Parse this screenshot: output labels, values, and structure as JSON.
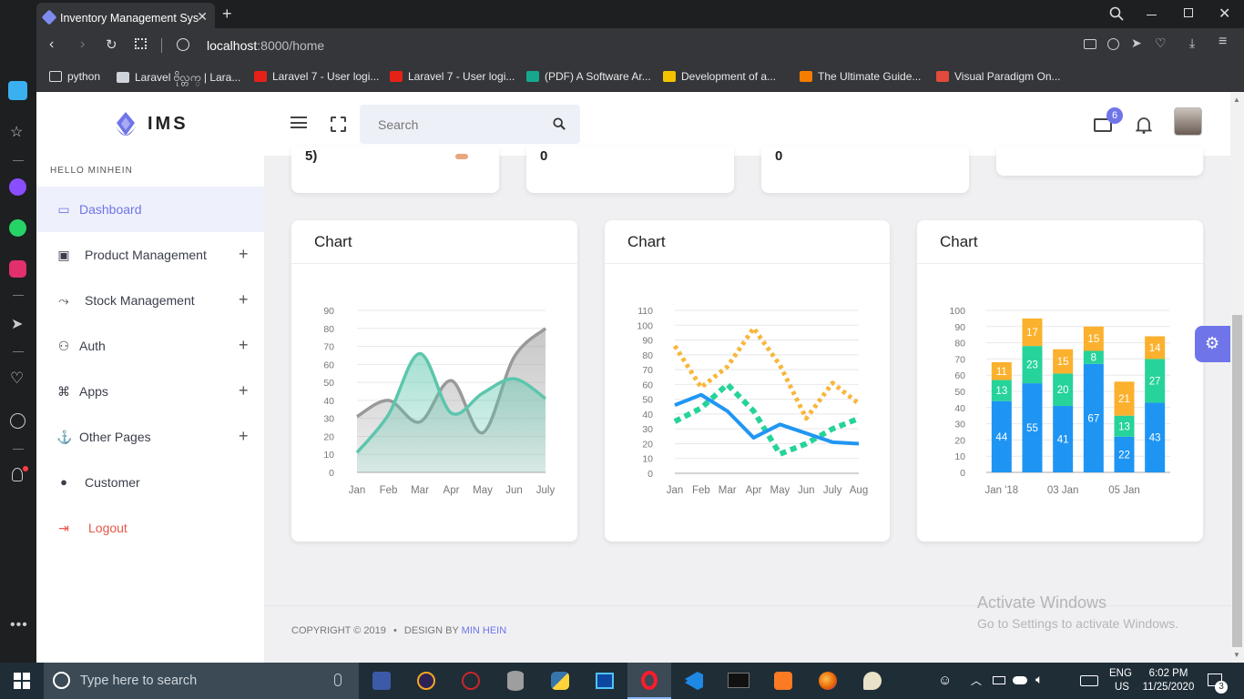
{
  "browser": {
    "tab_title": "Inventory Management Sys",
    "url_host": "localhost",
    "url_rest": ":8000/home",
    "bookmarks": [
      {
        "label": "python",
        "icon": "folder-icon",
        "color": "#35363a"
      },
      {
        "label": "Laravel ဗိုလ္တက္ | Lara...",
        "icon": "book-icon",
        "color": "#cfd4da"
      },
      {
        "label": "Laravel 7 - User logi...",
        "icon": "youtube-icon",
        "color": "#e62117"
      },
      {
        "label": "Laravel 7 - User logi...",
        "icon": "youtube-icon",
        "color": "#e62117"
      },
      {
        "label": "(PDF) A Software Ar...",
        "icon": "researchgate-icon",
        "color": "#17a78f"
      },
      {
        "label": "Development of a...",
        "icon": "ru-icon",
        "color": "#f3c300"
      },
      {
        "label": "The Ultimate Guide...",
        "icon": "in-icon",
        "color": "#f57c00"
      },
      {
        "label": "Visual Paradigm On...",
        "icon": "vp-icon",
        "color": "#e24a3b"
      }
    ]
  },
  "app": {
    "logo_text": "IMS",
    "greeting": "HELLO MINHEIN",
    "search_placeholder": "Search",
    "notification_count": "6",
    "menu": [
      {
        "label": "Dashboard",
        "icon": "monitor-icon",
        "expandable": false,
        "active": true
      },
      {
        "label": "Product Management",
        "icon": "box-icon",
        "expandable": true,
        "active": false
      },
      {
        "label": "Stock Management",
        "icon": "stock-icon",
        "expandable": true,
        "active": false
      },
      {
        "label": "Auth",
        "icon": "user-icon",
        "expandable": true,
        "active": false
      },
      {
        "label": "Apps",
        "icon": "command-icon",
        "expandable": true,
        "active": false
      },
      {
        "label": "Other Pages",
        "icon": "anchor-icon",
        "expandable": true,
        "active": false
      },
      {
        "label": "Customer",
        "icon": "person-circle-icon",
        "expandable": false,
        "active": false
      },
      {
        "label": "Logout",
        "icon": "logout-icon",
        "expandable": false,
        "active": false
      }
    ],
    "stat_cards_partial": [
      "5)",
      "0",
      "0",
      ""
    ],
    "footer": {
      "copyright": "COPYRIGHT © 2019",
      "design_by": "DESIGN BY",
      "author": "MIN HEIN"
    },
    "watermark": {
      "title": "Activate Windows",
      "subtitle": "Go to Settings to activate Windows."
    },
    "accent_color": "#6f75e8",
    "logout_color": "#e8574a"
  },
  "charts": {
    "titles": [
      "Chart",
      "Chart",
      "Chart"
    ]
  },
  "chart_data": [
    {
      "type": "area",
      "title": "Chart",
      "categories": [
        "Jan",
        "Feb",
        "Mar",
        "Apr",
        "May",
        "Jun",
        "July"
      ],
      "ylim": [
        0,
        90
      ],
      "yticks": [
        0,
        10,
        20,
        30,
        40,
        50,
        60,
        70,
        80,
        90
      ],
      "grid": true,
      "series": [
        {
          "color": "#5cc6ad",
          "values": [
            11,
            32,
            66,
            33,
            44,
            52,
            41
          ]
        },
        {
          "color": "#999999",
          "values": [
            31,
            40,
            28,
            51,
            22,
            64,
            80
          ]
        }
      ]
    },
    {
      "type": "line",
      "title": "Chart",
      "categories": [
        "Jan",
        "Feb",
        "Mar",
        "Apr",
        "May",
        "Jun",
        "July",
        "Aug"
      ],
      "ylim": [
        0,
        110
      ],
      "yticks": [
        0,
        10,
        20,
        30,
        40,
        50,
        60,
        70,
        80,
        90,
        100,
        110
      ],
      "grid": true,
      "series": [
        {
          "color": "#f8b63b",
          "style": "dotted",
          "values": [
            86,
            58,
            72,
            98,
            73,
            37,
            61,
            47
          ]
        },
        {
          "color": "#26d39a",
          "style": "dashed",
          "values": [
            35,
            44,
            60,
            42,
            13,
            20,
            30,
            37
          ]
        },
        {
          "color": "#2196f3",
          "style": "solid",
          "values": [
            46,
            53,
            42,
            24,
            33,
            27,
            21,
            20
          ]
        }
      ]
    },
    {
      "type": "bar",
      "stacked": true,
      "title": "Chart",
      "categories": [
        "Jan '18",
        "",
        "03 Jan",
        "",
        "05 Jan",
        ""
      ],
      "ylim": [
        0,
        100
      ],
      "yticks": [
        0,
        10,
        20,
        30,
        40,
        50,
        60,
        70,
        80,
        90,
        100
      ],
      "grid": true,
      "series": [
        {
          "color": "#1e95f3",
          "values": [
            44,
            55,
            41,
            67,
            22,
            43
          ]
        },
        {
          "color": "#26d39a",
          "values": [
            13,
            23,
            20,
            8,
            13,
            27
          ]
        },
        {
          "color": "#fbb12e",
          "values": [
            11,
            17,
            15,
            15,
            21,
            14
          ]
        }
      ]
    }
  ],
  "taskbar": {
    "search_placeholder": "Type here to search",
    "lang_top": "ENG",
    "lang_bottom": "US",
    "time": "6:02 PM",
    "date": "11/25/2020",
    "notifications": "3"
  }
}
